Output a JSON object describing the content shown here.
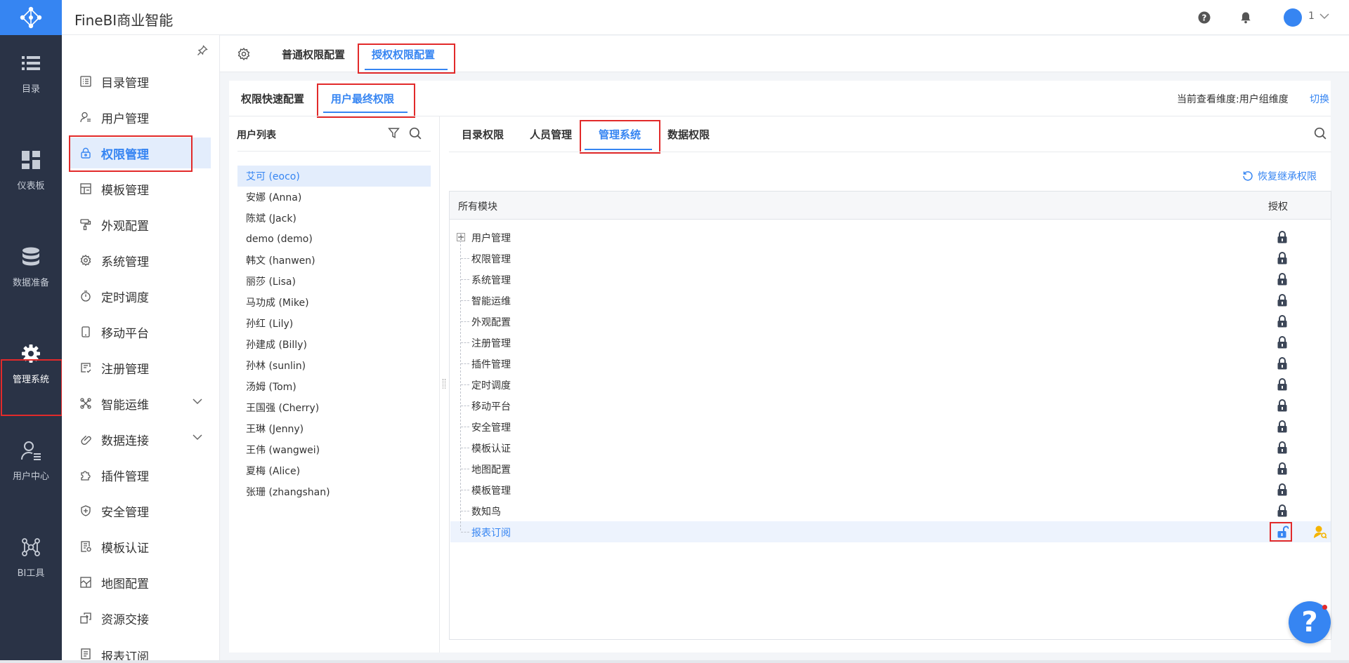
{
  "app": {
    "title": "FineBI商业智能",
    "user_name": "1"
  },
  "colors": {
    "accent": "#3685f2",
    "nav_bg": "#2a3346",
    "highlight": "#e22a2a",
    "warning": "#f5b400"
  },
  "left_nav": [
    {
      "label": "目录",
      "icon": "list-icon"
    },
    {
      "label": "仪表板",
      "icon": "dashboard-icon"
    },
    {
      "label": "数据准备",
      "icon": "database-icon"
    },
    {
      "label": "管理系统",
      "icon": "gear-icon"
    },
    {
      "label": "用户中心",
      "icon": "user-icon"
    },
    {
      "label": "BI工具",
      "icon": "network-icon"
    }
  ],
  "side_menu": [
    {
      "label": "目录管理",
      "icon": "catalog-icon"
    },
    {
      "label": "用户管理",
      "icon": "user-manage-icon"
    },
    {
      "label": "权限管理",
      "icon": "lock-icon"
    },
    {
      "label": "模板管理",
      "icon": "template-icon"
    },
    {
      "label": "外观配置",
      "icon": "paint-roller-icon"
    },
    {
      "label": "系统管理",
      "icon": "gear-icon"
    },
    {
      "label": "定时调度",
      "icon": "timer-icon"
    },
    {
      "label": "移动平台",
      "icon": "mobile-icon"
    },
    {
      "label": "注册管理",
      "icon": "register-icon"
    },
    {
      "label": "智能运维",
      "icon": "ops-icon"
    },
    {
      "label": "数据连接",
      "icon": "link-icon"
    },
    {
      "label": "插件管理",
      "icon": "plugin-icon"
    },
    {
      "label": "安全管理",
      "icon": "shield-icon"
    },
    {
      "label": "模板认证",
      "icon": "certify-icon"
    },
    {
      "label": "地图配置",
      "icon": "map-icon"
    },
    {
      "label": "资源交接",
      "icon": "handover-icon"
    },
    {
      "label": "报表订阅",
      "icon": "subscribe-icon"
    }
  ],
  "top_tabs": {
    "normal": "普通权限配置",
    "grant": "授权权限配置"
  },
  "sub_tabs": {
    "quick": "权限快速配置",
    "final": "用户最终权限"
  },
  "view_dimension": "当前查看维度:用户组维度",
  "switch_label": "切换",
  "user_list": {
    "title": "用户列表",
    "users": [
      "艾可 (eoco)",
      "安娜 (Anna)",
      "陈斌 (Jack)",
      "demo (demo)",
      "韩文 (hanwen)",
      "丽莎 (Lisa)",
      "马功成 (Mike)",
      "孙红 (Lily)",
      "孙建成 (Billy)",
      "孙林 (sunlin)",
      "汤姆 (Tom)",
      "王国强 (Cherry)",
      "王琳 (Jenny)",
      "王伟 (wangwei)",
      "夏梅 (Alice)",
      "张珊 (zhangshan)"
    ]
  },
  "perm_tabs": [
    "目录权限",
    "人员管理",
    "管理系统",
    "数据权限"
  ],
  "restore_label": "恢复继承权限",
  "table": {
    "col_module": "所有模块",
    "col_grant": "授权",
    "modules": [
      "用户管理",
      "权限管理",
      "系统管理",
      "智能运维",
      "外观配置",
      "注册管理",
      "插件管理",
      "定时调度",
      "移动平台",
      "安全管理",
      "模板认证",
      "地图配置",
      "模板管理",
      "数知鸟",
      "报表订阅"
    ]
  },
  "help_label": "?"
}
